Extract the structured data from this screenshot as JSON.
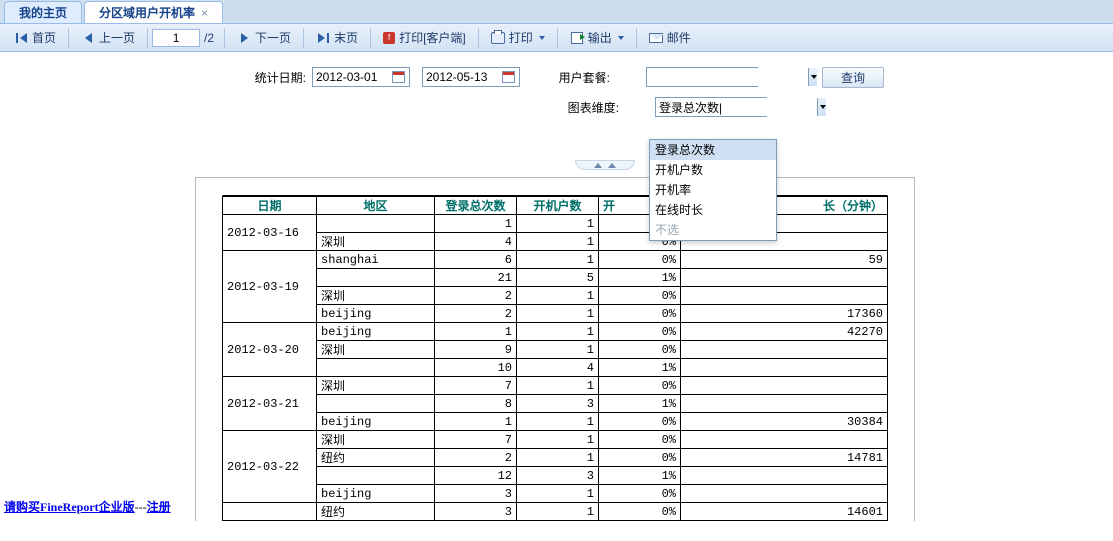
{
  "tabs": {
    "home": "我的主页",
    "active": "分区域用户开机率"
  },
  "toolbar": {
    "first": "首页",
    "prev": "上一页",
    "next": "下一页",
    "last": "末页",
    "page_current": "1",
    "page_total": "/2",
    "print_client": "打印[客户端]",
    "print": "打印",
    "export": "输出",
    "mail": "邮件"
  },
  "filters": {
    "date_label": "统计日期:",
    "date_from": "2012-03-01",
    "date_to": "2012-05-13",
    "package_label": "用户套餐:",
    "package_value": "",
    "dimension_label": "图表维度:",
    "dimension_value": "登录总次数|",
    "query": "查询"
  },
  "dropdown": {
    "items": [
      "登录总次数",
      "开机户数",
      "开机率",
      "在线时长"
    ],
    "disabled": "不选"
  },
  "columns": {
    "date": "日期",
    "area": "地区",
    "login": "登录总次数",
    "open_cnt": "开机户数",
    "open_rate_prefix": "开",
    "duration_suffix": "长（分钟）"
  },
  "rows": [
    {
      "date": "2012-03-16",
      "sub": [
        {
          "area": "",
          "login": "1",
          "open": "1",
          "rate": "",
          "dur": ""
        },
        {
          "area": "深圳",
          "login": "4",
          "open": "1",
          "rate": "0%",
          "dur": ""
        }
      ]
    },
    {
      "date": "2012-03-19",
      "sub": [
        {
          "area": "shanghai",
          "login": "6",
          "open": "1",
          "rate": "0%",
          "dur": "59"
        },
        {
          "area": "",
          "login": "21",
          "open": "5",
          "rate": "1%",
          "dur": ""
        },
        {
          "area": "深圳",
          "login": "2",
          "open": "1",
          "rate": "0%",
          "dur": ""
        },
        {
          "area": "beijing",
          "login": "2",
          "open": "1",
          "rate": "0%",
          "dur": "17360"
        }
      ]
    },
    {
      "date": "2012-03-20",
      "sub": [
        {
          "area": "beijing",
          "login": "1",
          "open": "1",
          "rate": "0%",
          "dur": "42270"
        },
        {
          "area": "深圳",
          "login": "9",
          "open": "1",
          "rate": "0%",
          "dur": ""
        },
        {
          "area": "",
          "login": "10",
          "open": "4",
          "rate": "1%",
          "dur": ""
        }
      ]
    },
    {
      "date": "2012-03-21",
      "sub": [
        {
          "area": "深圳",
          "login": "7",
          "open": "1",
          "rate": "0%",
          "dur": ""
        },
        {
          "area": "",
          "login": "8",
          "open": "3",
          "rate": "1%",
          "dur": ""
        },
        {
          "area": "beijing",
          "login": "1",
          "open": "1",
          "rate": "0%",
          "dur": "30384"
        }
      ]
    },
    {
      "date": "2012-03-22",
      "sub": [
        {
          "area": "深圳",
          "login": "7",
          "open": "1",
          "rate": "0%",
          "dur": ""
        },
        {
          "area": "纽约",
          "login": "2",
          "open": "1",
          "rate": "0%",
          "dur": "14781"
        },
        {
          "area": "",
          "login": "12",
          "open": "3",
          "rate": "1%",
          "dur": ""
        },
        {
          "area": "beijing",
          "login": "3",
          "open": "1",
          "rate": "0%",
          "dur": ""
        }
      ]
    },
    {
      "date": "",
      "sub": [
        {
          "area": "纽约",
          "login": "3",
          "open": "1",
          "rate": "0%",
          "dur": "14601"
        }
      ]
    }
  ],
  "footer": {
    "buy": "请购买FineReport企业版",
    "dash": "---",
    "register": "注册"
  }
}
